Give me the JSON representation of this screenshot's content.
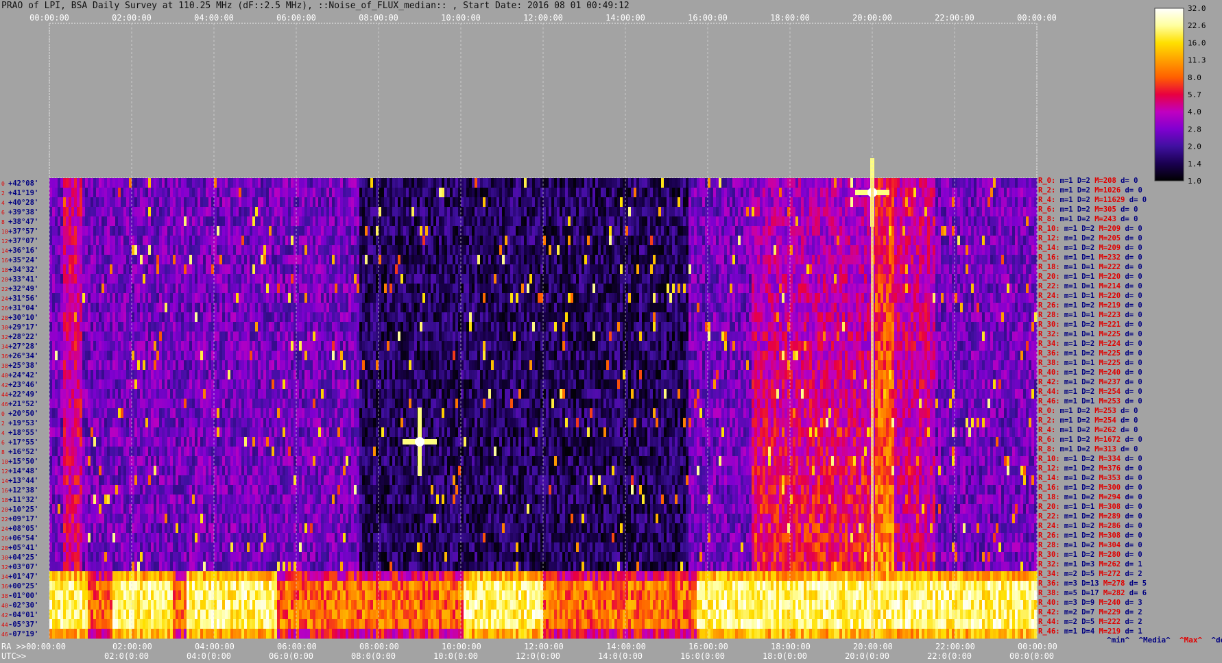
{
  "title": "PRAO of LPI, BSA Daily Survey at 110.25 MHz (dF::2.5 MHz), ::Noise_of_FLUX_median:: , Start Date: 2016 08 01 00:49:12",
  "chart_data": {
    "type": "heatmap",
    "title": "PRAO of LPI, BSA Daily Survey at 110.25 MHz (dF::2.5 MHz), ::Noise_of_FLUX_median:: , Start Date: 2016 08 01 00:49:12",
    "top_time_labels": [
      "00:00:00",
      "02:00:00",
      "04:00:00",
      "06:00:00",
      "08:00:00",
      "10:00:00",
      "12:00:00",
      "14:00:00",
      "16:00:00",
      "18:00:00",
      "20:00:00",
      "22:00:00",
      "00:00:00"
    ],
    "ra_labels": [
      "RA >>00:00:00",
      "02:00:00",
      "04:00:00",
      "06:00:00",
      "08:00:00",
      "10:00:00",
      "12:00:00",
      "14:00:00",
      "16:00:00",
      "18:00:00",
      "20:00:00",
      "22:00:00",
      "00:00:00"
    ],
    "utc_labels": [
      "UTC>>",
      "02:0(0:00",
      "04:0(0:00",
      "06:0(0:00",
      "08:0(0:00",
      "10:0(0:00",
      "12:0(0:00",
      "14:0(0:00",
      "16:0(0:00",
      "18:0(0:00",
      "20:0(0:00",
      "22:0(0:00",
      "00:0(0:00"
    ],
    "declinations": [
      "+42°08'",
      "+41°19'",
      "+40°28'",
      "+39°38'",
      "+38°47'",
      "+37°57'",
      "+37°07'",
      "+36°16'",
      "+35°24'",
      "+34°32'",
      "+33°41'",
      "+32°49'",
      "+31°56'",
      "+31°04'",
      "+30°10'",
      "+29°17'",
      "+28°22'",
      "+27°28'",
      "+26°34'",
      "+25°38'",
      "+24°42'",
      "+23°46'",
      "+22°49'",
      "+21°52'",
      "+20°50'",
      "+19°53'",
      "+18°55'",
      "+17°55'",
      "+16°52'",
      "+15°50'",
      "+14°48'",
      "+13°44'",
      "+12°38'",
      "+11°32'",
      "+10°25'",
      "+09°17'",
      "+08°05'",
      "+06°54'",
      "+05°41'",
      "+04°25'",
      "+03°07'",
      "+01°47'",
      "+00°25'",
      "-01°00'",
      "-02°30'",
      "-04°01'",
      "-05°37'",
      "-07°19'"
    ],
    "colorbar": {
      "ticks": [
        "32.0",
        "22.6",
        "16.0",
        "11.3",
        "8.0",
        "5.7",
        "4.0",
        "2.8",
        "2.0",
        "1.4",
        "1.0"
      ],
      "scale": "log",
      "colors": [
        "#000000",
        "#1a0050",
        "#4010a0",
        "#8000d0",
        "#c000c0",
        "#e80040",
        "#ff6000",
        "#ffa000",
        "#ffe000",
        "#ffffa0",
        "#ffffff"
      ]
    },
    "bright_sources": [
      {
        "time_h": 9.0,
        "dec": "+17°55'"
      },
      {
        "time_h": 20.0,
        "dec": "+41°19'"
      }
    ],
    "band_dec_range": [
      "+01°47'",
      "-07°19'"
    ],
    "stats": [
      {
        "r": "R_0:",
        "m": "m=1",
        "d": "D=2",
        "M": "M=208",
        "dev": "d= 0"
      },
      {
        "r": "R_2:",
        "m": "m=1",
        "d": "D=2",
        "M": "M=1026",
        "dev": "d= 0"
      },
      {
        "r": "R_4:",
        "m": "m=1",
        "d": "D=2",
        "M": "M=11629",
        "dev": "d= 0"
      },
      {
        "r": "R_6:",
        "m": "m=1",
        "d": "D=2",
        "M": "M=305",
        "dev": "d= 0"
      },
      {
        "r": "R_8:",
        "m": "m=1",
        "d": "D=2",
        "M": "M=243",
        "dev": "d= 0"
      },
      {
        "r": "R_10:",
        "m": "m=1",
        "d": "D=2",
        "M": "M=209",
        "dev": "d= 0"
      },
      {
        "r": "R_12:",
        "m": "m=1",
        "d": "D=2",
        "M": "M=205",
        "dev": "d= 0"
      },
      {
        "r": "R_14:",
        "m": "m=1",
        "d": "D=2",
        "M": "M=209",
        "dev": "d= 0"
      },
      {
        "r": "R_16:",
        "m": "m=1",
        "d": "D=1",
        "M": "M=232",
        "dev": "d= 0"
      },
      {
        "r": "R_18:",
        "m": "m=1",
        "d": "D=1",
        "M": "M=222",
        "dev": "d= 0"
      },
      {
        "r": "R_20:",
        "m": "m=1",
        "d": "D=1",
        "M": "M=220",
        "dev": "d= 0"
      },
      {
        "r": "R_22:",
        "m": "m=1",
        "d": "D=1",
        "M": "M=214",
        "dev": "d= 0"
      },
      {
        "r": "R_24:",
        "m": "m=1",
        "d": "D=1",
        "M": "M=220",
        "dev": "d= 0"
      },
      {
        "r": "R_26:",
        "m": "m=1",
        "d": "D=2",
        "M": "M=219",
        "dev": "d= 0"
      },
      {
        "r": "R_28:",
        "m": "m=1",
        "d": "D=1",
        "M": "M=223",
        "dev": "d= 0"
      },
      {
        "r": "R_30:",
        "m": "m=1",
        "d": "D=2",
        "M": "M=221",
        "dev": "d= 0"
      },
      {
        "r": "R_32:",
        "m": "m=1",
        "d": "D=1",
        "M": "M=225",
        "dev": "d= 0"
      },
      {
        "r": "R_34:",
        "m": "m=1",
        "d": "D=2",
        "M": "M=224",
        "dev": "d= 0"
      },
      {
        "r": "R_36:",
        "m": "m=1",
        "d": "D=2",
        "M": "M=225",
        "dev": "d= 0"
      },
      {
        "r": "R_38:",
        "m": "m=1",
        "d": "D=1",
        "M": "M=225",
        "dev": "d= 0"
      },
      {
        "r": "R_40:",
        "m": "m=1",
        "d": "D=2",
        "M": "M=240",
        "dev": "d= 0"
      },
      {
        "r": "R_42:",
        "m": "m=1",
        "d": "D=2",
        "M": "M=237",
        "dev": "d= 0"
      },
      {
        "r": "R_44:",
        "m": "m=1",
        "d": "D=2",
        "M": "M=254",
        "dev": "d= 0"
      },
      {
        "r": "R_46:",
        "m": "m=1",
        "d": "D=1",
        "M": "M=253",
        "dev": "d= 0"
      },
      {
        "r": "R_0:",
        "m": "m=1",
        "d": "D=2",
        "M": "M=253",
        "dev": "d= 0"
      },
      {
        "r": "R_2:",
        "m": "m=1",
        "d": "D=2",
        "M": "M=254",
        "dev": "d= 0"
      },
      {
        "r": "R_4:",
        "m": "m=1",
        "d": "D=2",
        "M": "M=262",
        "dev": "d= 0"
      },
      {
        "r": "R_6:",
        "m": "m=1",
        "d": "D=2",
        "M": "M=1672",
        "dev": "d= 0"
      },
      {
        "r": "R_8:",
        "m": "m=1",
        "d": "D=2",
        "M": "M=313",
        "dev": "d= 0"
      },
      {
        "r": "R_10:",
        "m": "m=1",
        "d": "D=2",
        "M": "M=334",
        "dev": "d= 0"
      },
      {
        "r": "R_12:",
        "m": "m=1",
        "d": "D=2",
        "M": "M=376",
        "dev": "d= 0"
      },
      {
        "r": "R_14:",
        "m": "m=1",
        "d": "D=2",
        "M": "M=353",
        "dev": "d= 0"
      },
      {
        "r": "R_16:",
        "m": "m=1",
        "d": "D=2",
        "M": "M=300",
        "dev": "d= 0"
      },
      {
        "r": "R_18:",
        "m": "m=1",
        "d": "D=2",
        "M": "M=294",
        "dev": "d= 0"
      },
      {
        "r": "R_20:",
        "m": "m=1",
        "d": "D=1",
        "M": "M=308",
        "dev": "d= 0"
      },
      {
        "r": "R_22:",
        "m": "m=1",
        "d": "D=2",
        "M": "M=289",
        "dev": "d= 0"
      },
      {
        "r": "R_24:",
        "m": "m=1",
        "d": "D=2",
        "M": "M=286",
        "dev": "d= 0"
      },
      {
        "r": "R_26:",
        "m": "m=1",
        "d": "D=2",
        "M": "M=308",
        "dev": "d= 0"
      },
      {
        "r": "R_28:",
        "m": "m=1",
        "d": "D=2",
        "M": "M=304",
        "dev": "d= 0"
      },
      {
        "r": "R_30:",
        "m": "m=1",
        "d": "D=2",
        "M": "M=280",
        "dev": "d= 0"
      },
      {
        "r": "R_32:",
        "m": "m=1",
        "d": "D=3",
        "M": "M=262",
        "dev": "d= 1"
      },
      {
        "r": "R_34:",
        "m": "m=2",
        "d": "D=5",
        "M": "M=272",
        "dev": "d= 2"
      },
      {
        "r": "R_36:",
        "m": "m=3",
        "d": "D=13",
        "M": "M=278",
        "dev": "d= 5"
      },
      {
        "r": "R_38:",
        "m": "m=5",
        "d": "D=17",
        "M": "M=282",
        "dev": "d= 6"
      },
      {
        "r": "R_40:",
        "m": "m=3",
        "d": "D=9",
        "M": "M=240",
        "dev": "d= 3"
      },
      {
        "r": "R_42:",
        "m": "m=2",
        "d": "D=7",
        "M": "M=229",
        "dev": "d= 2"
      },
      {
        "r": "R_44:",
        "m": "m=2",
        "d": "D=5",
        "M": "M=222",
        "dev": "d= 2"
      },
      {
        "r": "R_46:",
        "m": "m=1",
        "d": "D=4",
        "M": "M=219",
        "dev": "d= 1"
      }
    ],
    "legend": [
      {
        "text": "^min^",
        "color": "#000080"
      },
      {
        "text": "^Media^",
        "color": "#000080"
      },
      {
        "text": "^Max^",
        "color": "#e00000"
      },
      {
        "text": "^devia^",
        "color": "#000080"
      }
    ]
  }
}
